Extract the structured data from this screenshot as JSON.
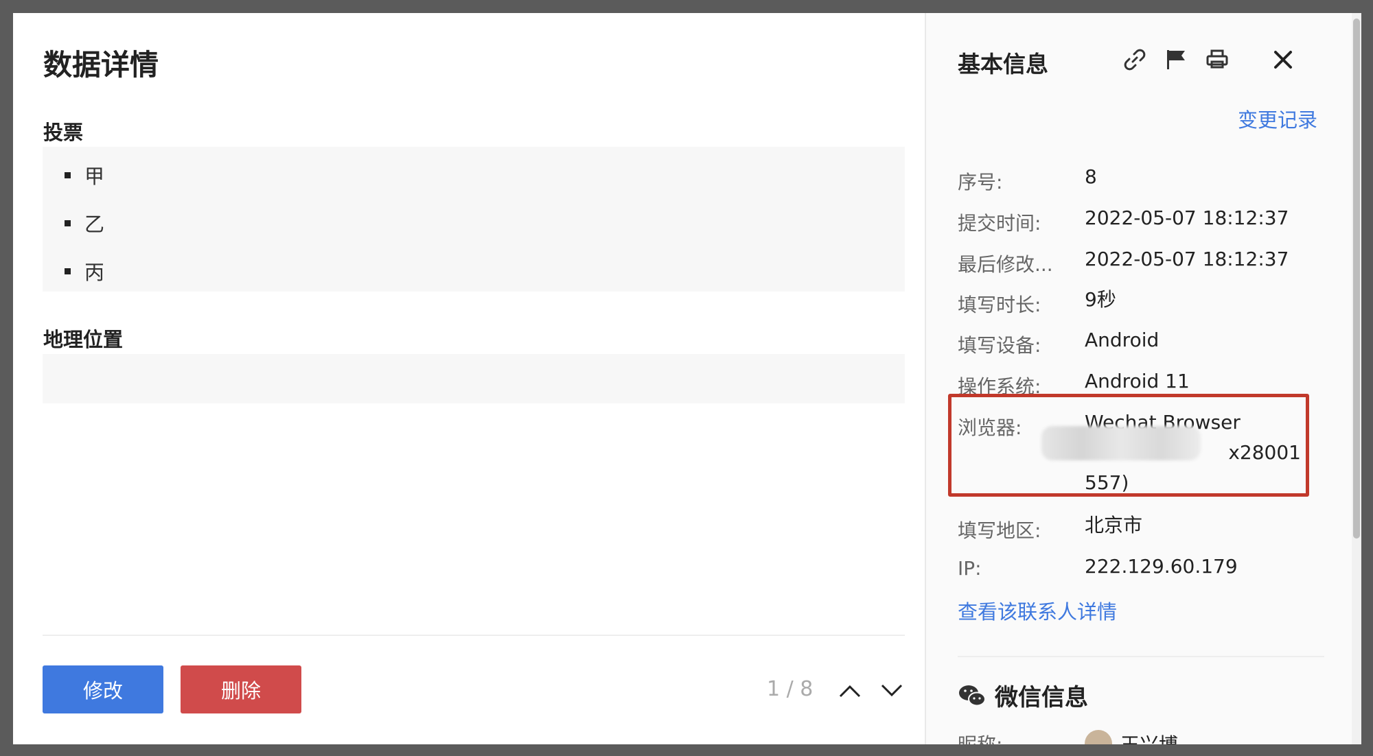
{
  "main": {
    "title": "数据详情",
    "questions": [
      {
        "label": "投票",
        "options": [
          "甲",
          "乙",
          "丙"
        ]
      },
      {
        "label": "地理位置",
        "value": ""
      }
    ],
    "edit_label": "修改",
    "delete_label": "删除",
    "pager_text": "1 / 8"
  },
  "side": {
    "title": "基本信息",
    "icons": [
      "link-icon",
      "flag-icon",
      "print-icon",
      "close-icon"
    ],
    "change_log_label": "变更记录",
    "fields": [
      {
        "key": "序号:",
        "value": "8"
      },
      {
        "key": "提交时间:",
        "value": "2022-05-07 18:12:37"
      },
      {
        "key": "最后修改...",
        "value": "2022-05-07 18:12:37"
      },
      {
        "key": "填写时长:",
        "value": "9秒"
      },
      {
        "key": "填写设备:",
        "value": "Android"
      },
      {
        "key": "操作系统:",
        "value": "Android 11"
      },
      {
        "key": "浏览器:",
        "value": "Wechat Browser",
        "value_line2": "x28001",
        "value_line3": "557)"
      },
      {
        "key": "填写地区:",
        "value": "北京市"
      },
      {
        "key": "IP:",
        "value": "222.129.60.179"
      }
    ],
    "contact_link": "查看该联系人详情",
    "wechat_title": "微信信息",
    "nickname_key": "昵称:",
    "nickname_value": "王兴博"
  },
  "colors": {
    "accent": "#3f79df",
    "danger": "#d04b4b",
    "highlight": "#c1392b"
  }
}
